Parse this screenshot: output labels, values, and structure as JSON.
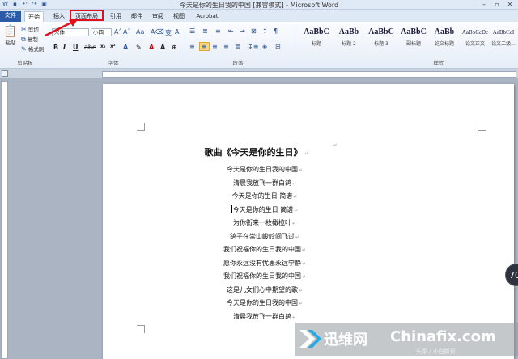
{
  "window": {
    "title": "今天是你的生日我的中国 [兼容模式] - Microsoft Word",
    "controls": [
      "–",
      "▫",
      "✕"
    ]
  },
  "tabs": [
    {
      "label": "文件"
    },
    {
      "label": "开始"
    },
    {
      "label": "插入"
    },
    {
      "label": "页面布局"
    },
    {
      "label": "引用"
    },
    {
      "label": "邮件"
    },
    {
      "label": "审阅"
    },
    {
      "label": "视图"
    },
    {
      "label": "Acrobat"
    }
  ],
  "ribbon": {
    "clipboard": {
      "cut": "剪切",
      "copy": "复制",
      "format_painter": "格式刷",
      "paste": "粘贴",
      "group": "剪贴板"
    },
    "font": {
      "name": "宋体",
      "size": "小四",
      "group": "字体"
    },
    "paragraph": {
      "group": "段落"
    },
    "styles": {
      "group": "样式",
      "items": [
        {
          "sample": "AaBbC",
          "name": "标题"
        },
        {
          "sample": "AaBb",
          "name": "标题 2"
        },
        {
          "sample": "AaBbC",
          "name": "标题 3"
        },
        {
          "sample": "AaBbC",
          "name": "副标题"
        },
        {
          "sample": "AaBb",
          "name": "论文标题"
        },
        {
          "sample": "AaBbCcDc",
          "name": "论文正文"
        },
        {
          "sample": "AaBbCcI",
          "name": "论文二级..."
        }
      ]
    }
  },
  "document": {
    "title": "歌曲《今天是你的生日》",
    "lines": [
      "今天是你的生日我的中国",
      "清晨我放飞一群白鸽",
      "今天是你的生日 简谱",
      "今天是你的生日 简谱",
      "为你衔来一枚橄榄叶",
      "鸽子在崇山峻岭间飞过",
      "我们祝福你的生日我的中国",
      "愿你永远没有忧患永远宁静",
      "我们祝福你的生日我的中国",
      "这是儿女们心中期望的歌",
      "今天是你的生日我的中国",
      "清晨我放飞一群白鸽"
    ]
  },
  "watermark": {
    "cn": "迅维网",
    "en": "Chinafix.com",
    "sub": "头条 / 小白知识"
  },
  "badge": "70"
}
